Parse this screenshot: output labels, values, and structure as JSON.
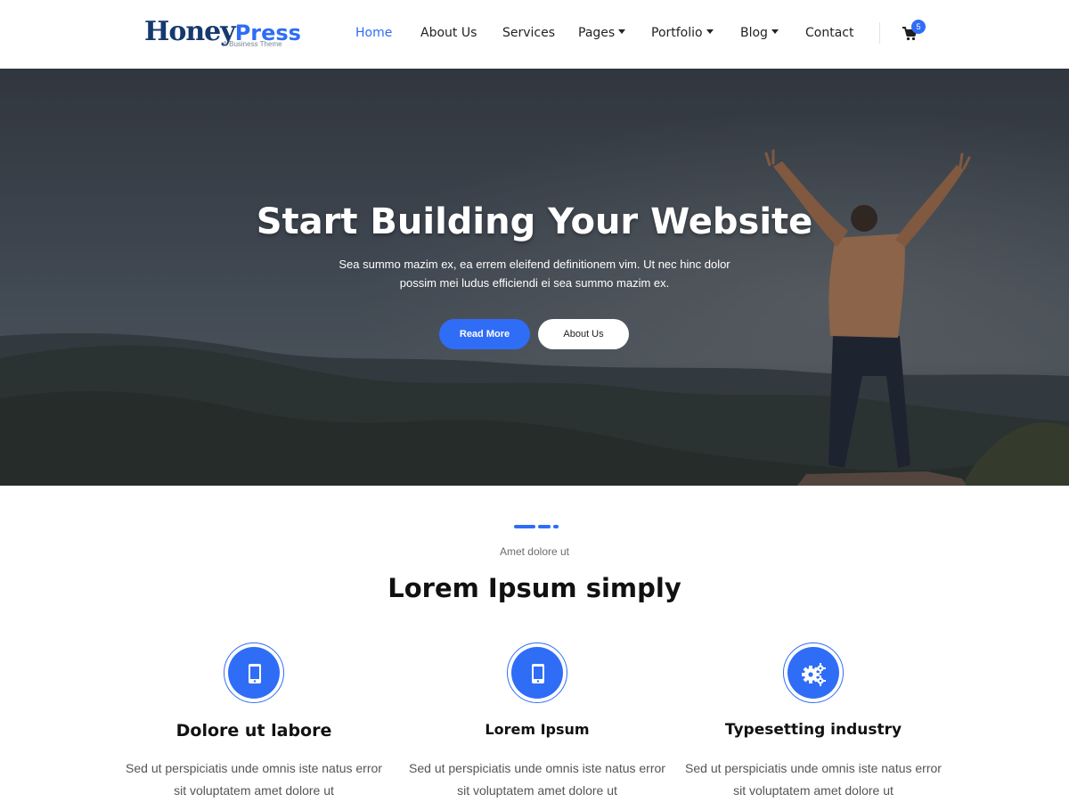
{
  "brand": {
    "name_part1": "Honey",
    "name_part2": "Press",
    "tagline": "A Business Theme"
  },
  "nav": {
    "items": [
      {
        "label": "Home",
        "active": true,
        "dropdown": false
      },
      {
        "label": "About Us",
        "active": false,
        "dropdown": false
      },
      {
        "label": "Services",
        "active": false,
        "dropdown": false
      },
      {
        "label": "Pages",
        "active": false,
        "dropdown": true
      },
      {
        "label": "Portfolio",
        "active": false,
        "dropdown": true
      },
      {
        "label": "Blog",
        "active": false,
        "dropdown": true
      },
      {
        "label": "Contact",
        "active": false,
        "dropdown": false
      }
    ],
    "cart_icon": "shopping-cart-icon",
    "cart_count": "5"
  },
  "hero": {
    "title": "Start Building Your Website",
    "text": "Sea summo mazim ex, ea errem eleifend definitionem vim. Ut nec hinc dolor possim mei ludus efficiendi ei sea summo mazim ex.",
    "primary_button": "Read More",
    "secondary_button": "About Us"
  },
  "section": {
    "kicker": "Amet dolore ut",
    "title": "Lorem Ipsum simply",
    "features": [
      {
        "icon": "mobile-phone-icon",
        "title": "Dolore ut labore",
        "text": "Sed ut perspiciatis unde omnis iste natus error sit voluptatem amet dolore ut"
      },
      {
        "icon": "mobile-phone-icon",
        "title": "Lorem Ipsum",
        "text": "Sed ut perspiciatis unde omnis iste natus error sit voluptatem amet dolore ut"
      },
      {
        "icon": "gears-icon",
        "title": "Typesetting industry",
        "text": "Sed ut perspiciatis unde omnis iste natus error sit voluptatem amet dolore ut"
      }
    ]
  },
  "colors": {
    "accent": "#2f6df6",
    "brand_dark": "#163a6e",
    "text_dark": "#111111",
    "text_muted": "#555555"
  }
}
